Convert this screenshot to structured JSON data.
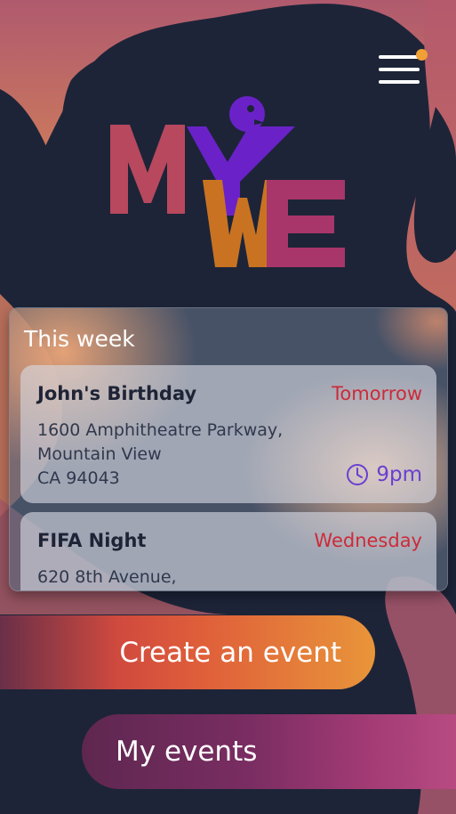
{
  "app": {
    "logo_text": "MYWE",
    "colors": {
      "background": "#1d2438",
      "accent_orange": "#f0a035",
      "accent_red": "#cc2b3a",
      "accent_purple": "#6a3fd0"
    }
  },
  "header": {
    "menu_icon": "hamburger-menu-icon",
    "notification_dot": true
  },
  "this_week": {
    "title": "This week",
    "events": [
      {
        "name": "John's Birthday",
        "day": "Tomorrow",
        "address_lines": [
          "1600 Amphitheatre Parkway,",
          "Mountain View",
          "CA 94043"
        ],
        "time": "9pm",
        "time_icon": "clock-icon"
      },
      {
        "name": "FIFA Night",
        "day": "Wednesday",
        "address_lines": [
          "620 8th Avenue,"
        ]
      }
    ]
  },
  "actions": {
    "create_label": "Create an event",
    "my_events_label": "My events"
  }
}
